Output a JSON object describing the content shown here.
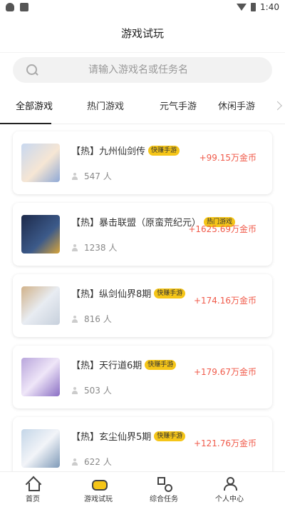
{
  "status_bar": {
    "time": "1:40"
  },
  "header": {
    "title": "游戏试玩"
  },
  "search": {
    "placeholder": "请输入游戏名或任务名"
  },
  "tabs": [
    {
      "label": "全部游戏",
      "active": true
    },
    {
      "label": "热门游戏",
      "active": false
    },
    {
      "label": "元气手游",
      "active": false
    },
    {
      "label": "休闲手游",
      "active": false
    }
  ],
  "games": [
    {
      "name": "【热】九州仙剑传",
      "badge": "快赚手游",
      "players": "547 人",
      "reward": "+99.15万金币",
      "thumb_colors": [
        "#c8d8f0",
        "#f6e6d4",
        "#8fa9d6"
      ]
    },
    {
      "name": "【热】暴击联盟（原蛮荒纪元）",
      "badge": "热门游戏",
      "players": "1238 人",
      "reward": "+1625.69万金币",
      "thumb_colors": [
        "#1d2a4a",
        "#3c5a8a",
        "#d9a53a"
      ]
    },
    {
      "name": "【热】纵剑仙界8期",
      "badge": "快赚手游",
      "players": "816 人",
      "reward": "+174.16万金币",
      "thumb_colors": [
        "#e8ecf2",
        "#c7d0dc",
        "#d1b28a"
      ]
    },
    {
      "name": "【热】天行道6期",
      "badge": "快赚手游",
      "players": "503 人",
      "reward": "+179.67万金币",
      "thumb_colors": [
        "#b9a6dc",
        "#efe6f8",
        "#8a6fc4"
      ]
    },
    {
      "name": "【热】玄尘仙界5期",
      "badge": "快赚手游",
      "players": "622 人",
      "reward": "+121.76万金币",
      "thumb_colors": [
        "#c4d6e8",
        "#f2f4f8",
        "#7f9ab8"
      ]
    }
  ],
  "bottom_nav": [
    {
      "label": "首页",
      "icon": "home-icon"
    },
    {
      "label": "游戏试玩",
      "icon": "gamepad-icon",
      "active": true
    },
    {
      "label": "综合任务",
      "icon": "grid-icon"
    },
    {
      "label": "个人中心",
      "icon": "user-center-icon"
    }
  ],
  "colors": {
    "accent": "#f5c518",
    "reward": "#f05a4a"
  }
}
